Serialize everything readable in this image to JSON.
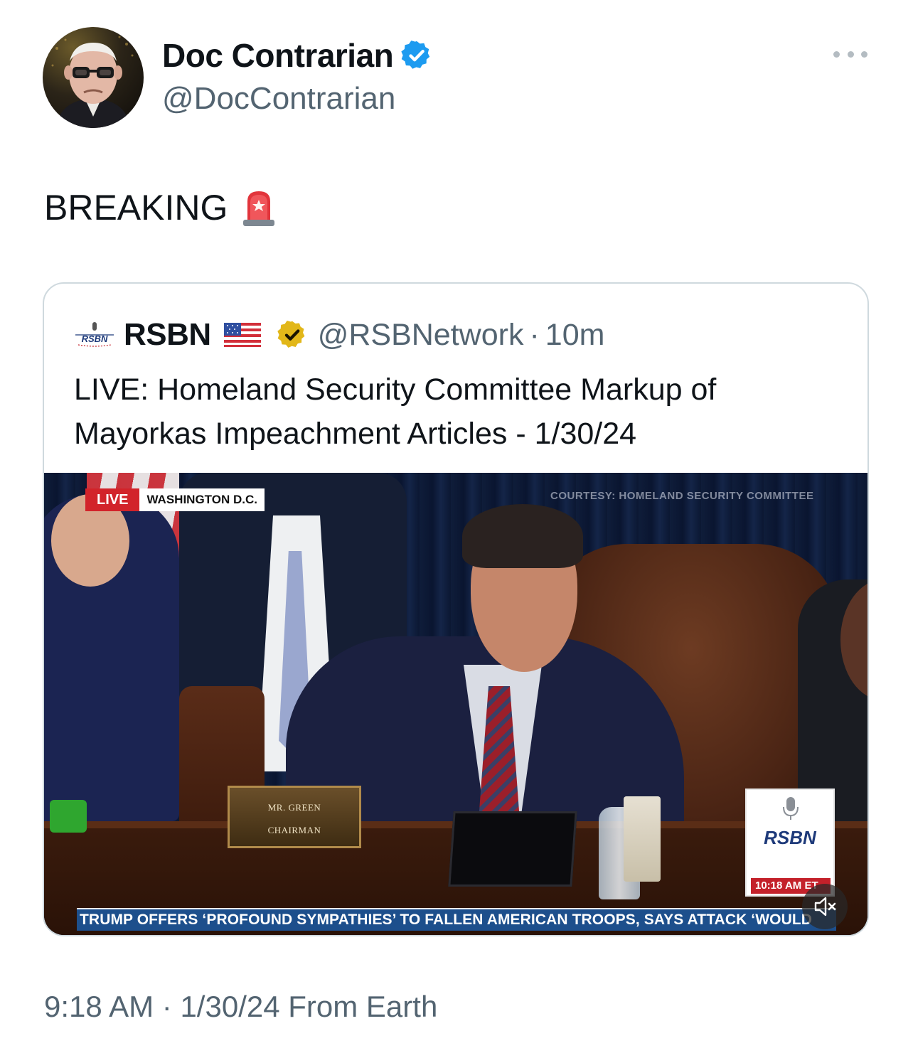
{
  "post": {
    "author_name": "Doc Contrarian",
    "author_handle": "@DocContrarian",
    "text": "BREAKING",
    "timestamp": "9:18 AM",
    "date": "1/30/24",
    "source": "From Earth",
    "separator": "·"
  },
  "quoted": {
    "name": "RSBN",
    "handle": "@RSBNetwork",
    "separator": "·",
    "age": "10m",
    "text": "LIVE: Homeland Security Committee Markup of Mayorkas Impeachment Articles - 1/30/24",
    "logo_text": "RSBN"
  },
  "video": {
    "live_label": "LIVE",
    "location": "WASHINGTON D.C.",
    "courtesy": "COURTESY: HOMELAND SECURITY COMMITTEE",
    "nameplate_name": "MR. GREEN",
    "nameplate_title": "CHAIRMAN",
    "corner_logo": "RSBN",
    "corner_time": "10:18 AM ET",
    "ticker": "TRUMP OFFERS ‘PROFOUND SYMPATHIES’ TO FALLEN AMERICAN TROOPS, SAYS ATTACK ‘WOULD"
  },
  "icons": {
    "verified": "verified-badge-icon",
    "siren": "police-light-emoji",
    "flag": "us-flag-emoji",
    "gold_verified": "gold-verified-badge-icon",
    "more": "more-options-icon",
    "mute": "muted-speaker-icon"
  },
  "colors": {
    "verified_blue": "#1d9bf0",
    "gold_badge": "#e2b719",
    "secondary_text": "#536471",
    "live_red": "#d2232a",
    "ticker_blue": "#1d4f8c"
  }
}
